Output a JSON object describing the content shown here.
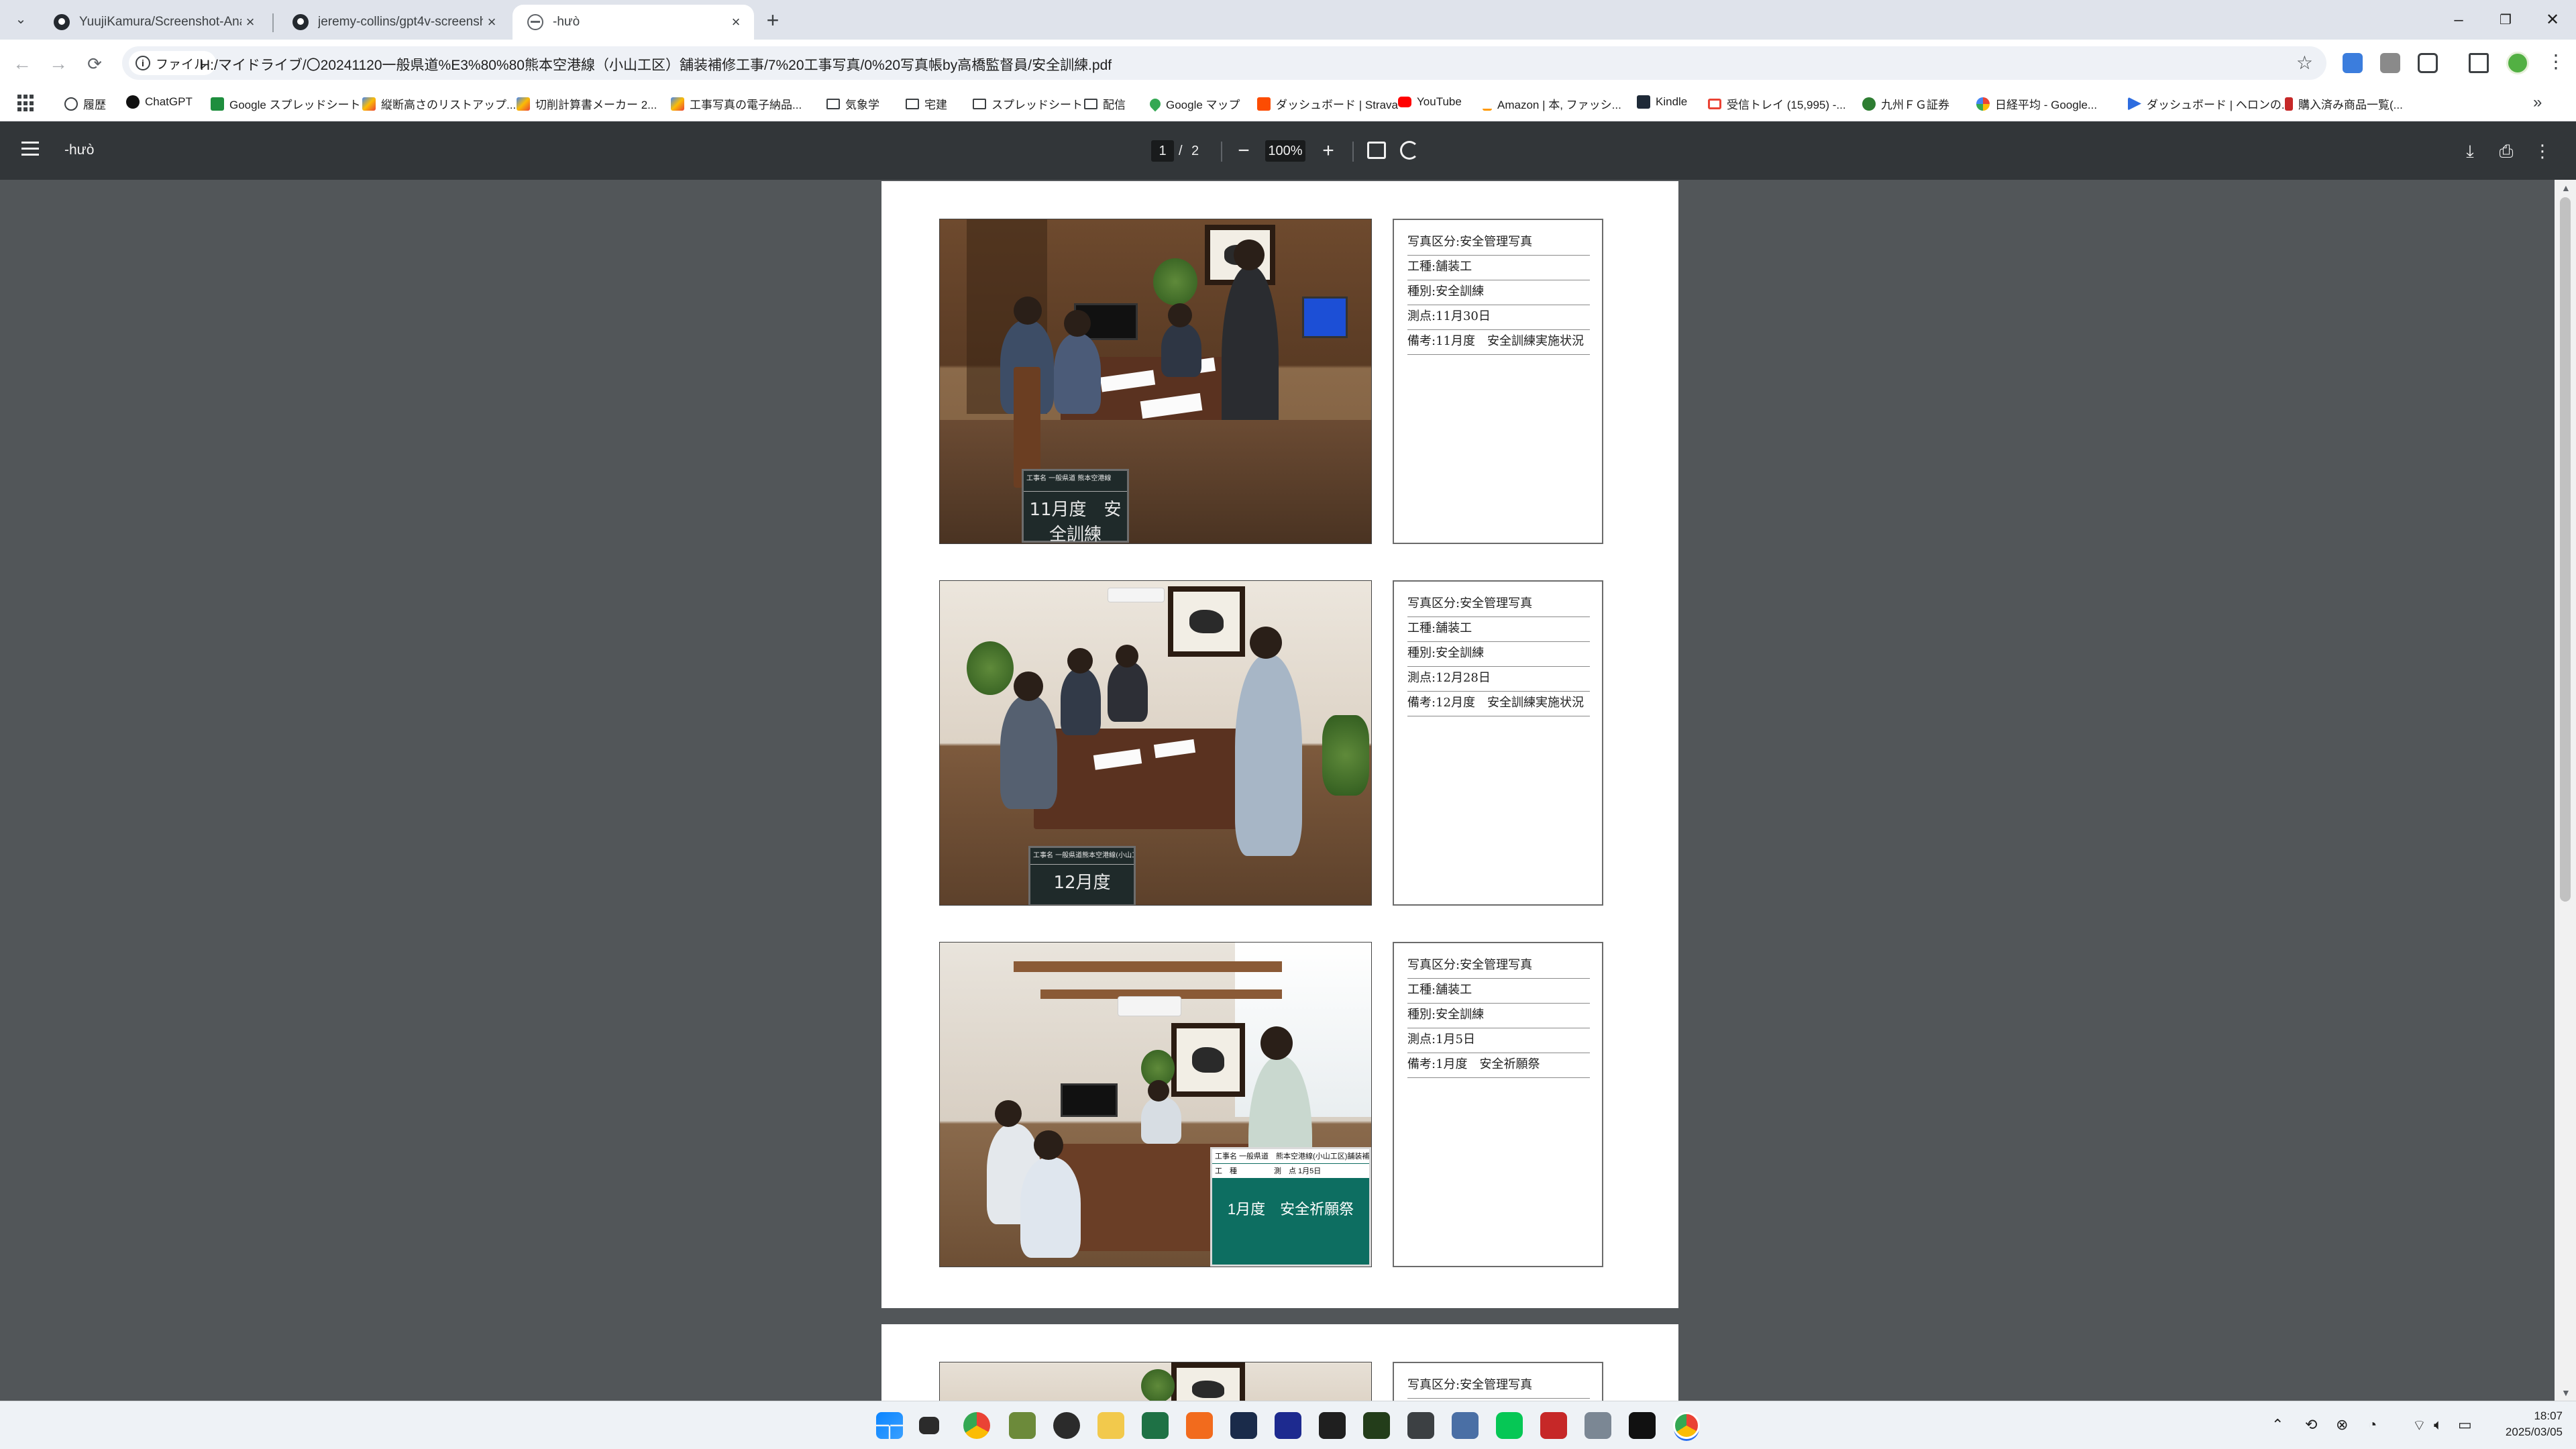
{
  "browser": {
    "tabs": [
      {
        "title": "YuujiKamura/Screenshot-Analy",
        "active": false,
        "favicon": "github-icon"
      },
      {
        "title": "jeremy-collins/gpt4v-screensh",
        "active": false,
        "favicon": "github-icon"
      },
      {
        "title": "-hưò",
        "active": true,
        "favicon": "globe-icon"
      }
    ],
    "file_chip": "ファイル",
    "url": "H:/マイドライブ/〇20241120一般県道%E3%80%80熊本空港線（小山工区）舗装補修工事/7%20工事写真/0%20写真帳by高橋監督員/安全訓練.pdf",
    "bookmarks": [
      {
        "label": "履歴",
        "icon": "history-icon"
      },
      {
        "label": "ChatGPT",
        "icon": "chatgpt-icon"
      },
      {
        "label": "Google スプレッドシート",
        "icon": "sheets-icon"
      },
      {
        "label": "縦断高さのリストアップ...",
        "icon": "app-icon"
      },
      {
        "label": "切削計算書メーカー 2...",
        "icon": "app-icon"
      },
      {
        "label": "工事写真の電子納品...",
        "icon": "app-icon"
      },
      {
        "label": "気象学",
        "icon": "folder-icon"
      },
      {
        "label": "宅建",
        "icon": "folder-icon"
      },
      {
        "label": "スプレッドシート",
        "icon": "folder-icon"
      },
      {
        "label": "配信",
        "icon": "folder-icon"
      },
      {
        "label": "Google マップ",
        "icon": "maps-icon"
      },
      {
        "label": "ダッシュボード | Strava",
        "icon": "strava-icon"
      },
      {
        "label": "YouTube",
        "icon": "youtube-icon"
      },
      {
        "label": "Amazon | 本, ファッシ...",
        "icon": "amazon-icon"
      },
      {
        "label": "Kindle",
        "icon": "kindle-icon"
      },
      {
        "label": "受信トレイ (15,995) -...",
        "icon": "gmail-icon"
      },
      {
        "label": "九州ＦＧ証券",
        "icon": "fg-icon"
      },
      {
        "label": "日経平均 - Google...",
        "icon": "google-icon"
      },
      {
        "label": "ダッシュボード | ヘロンの...",
        "icon": "dashboard-icon"
      },
      {
        "label": "購入済み商品一覧(...",
        "icon": "f-icon"
      }
    ]
  },
  "pdf_viewer": {
    "title": "-hưò",
    "current_page": "1",
    "page_separator": "/",
    "total_pages": "2",
    "zoom": "100%"
  },
  "photos": [
    {
      "lines": [
        "写真区分:安全管理写真",
        "工種:舗装工",
        "種別:安全訓練",
        "測点:11月30日",
        "備考:11月度　安全訓練実施状況"
      ],
      "board_text": "11月度　安全訓練",
      "board_header": "工事名 一般県道 熊本空港線"
    },
    {
      "lines": [
        "写真区分:安全管理写真",
        "工種:舗装工",
        "種別:安全訓練",
        "測点:12月28日",
        "備考:12月度　安全訓練実施状況"
      ],
      "board_text": "12月度",
      "board_header": "工事名 一般県道熊本空港線(小山工区)舗装補修工事"
    },
    {
      "lines": [
        "写真区分:安全管理写真",
        "工種:舗装工",
        "種別:安全訓練",
        "測点:1月5日",
        "備考:1月度　安全祈願祭"
      ],
      "board_text": "1月度　安全祈願祭",
      "board_header": "工事名 一般県道　熊本空港線(小山工区)舗装補修工事",
      "board_row2": "工　種　　　　　測　点 1月5日"
    }
  ],
  "page2_preview": {
    "lines": [
      "写真区分:安全管理写真"
    ]
  },
  "taskbar": {
    "time": "18:07",
    "date": "2025/03/05"
  }
}
